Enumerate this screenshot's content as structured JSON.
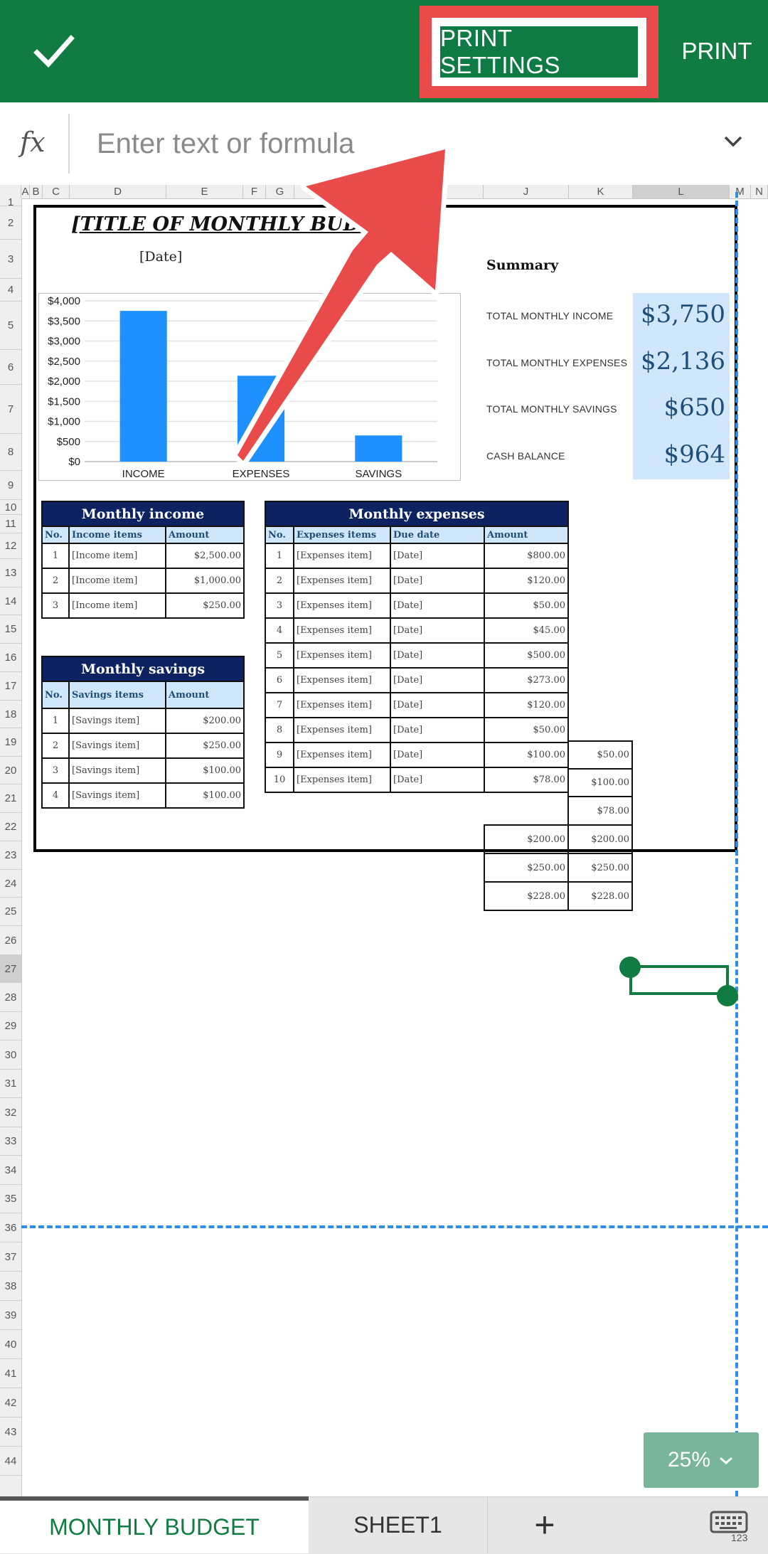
{
  "topbar": {
    "print_settings_label": "PRINT SETTINGS",
    "print_label": "PRINT"
  },
  "formula": {
    "fx_label": "fx",
    "placeholder": "Enter text or formula"
  },
  "columns": [
    "A",
    "B",
    "C",
    "D",
    "E",
    "F",
    "G",
    "H",
    "I",
    "J",
    "K",
    "L",
    "M",
    "N"
  ],
  "rows": [
    "1",
    "2",
    "3",
    "4",
    "5",
    "6",
    "7",
    "8",
    "9",
    "10",
    "11",
    "12",
    "13",
    "14",
    "15",
    "16",
    "17",
    "18",
    "19",
    "20",
    "21",
    "22",
    "23",
    "24",
    "25",
    "26",
    "27",
    "28",
    "29",
    "30",
    "31",
    "32",
    "33",
    "34",
    "35",
    "36",
    "37",
    "38",
    "39",
    "40",
    "41",
    "42",
    "43",
    "44"
  ],
  "sheet": {
    "title": "[TITLE OF MONTHLY BUDGET]",
    "date": "[Date]",
    "summary": {
      "heading": "Summary",
      "items": [
        {
          "label": "TOTAL MONTHLY  INCOME",
          "value": "$3,750"
        },
        {
          "label": "TOTAL MONTHLY  EXPENSES",
          "value": "$2,136"
        },
        {
          "label": "TOTAL MONTHLY  SAVINGS",
          "value": "$650"
        },
        {
          "label": "CASH BALANCE",
          "value": "$964"
        }
      ]
    },
    "income": {
      "title": "Monthly income",
      "headers": [
        "No.",
        "Income items",
        "Amount"
      ],
      "rows": [
        [
          "1",
          "[Income item]",
          "$2,500.00"
        ],
        [
          "2",
          "[Income item]",
          "$1,000.00"
        ],
        [
          "3",
          "[Income item]",
          "$250.00"
        ]
      ]
    },
    "savings": {
      "title": "Monthly savings",
      "headers": [
        "No.",
        "Savings items",
        "Amount"
      ],
      "rows": [
        [
          "1",
          "[Savings item]",
          "$200.00"
        ],
        [
          "2",
          "[Savings item]",
          "$250.00"
        ],
        [
          "3",
          "[Savings item]",
          "$100.00"
        ],
        [
          "4",
          "[Savings item]",
          "$100.00"
        ]
      ]
    },
    "expenses": {
      "title": "Monthly expenses",
      "headers": [
        "No.",
        "Expenses items",
        "Due date",
        "Amount"
      ],
      "rows": [
        [
          "1",
          "[Expenses item]",
          "[Date]",
          "$800.00"
        ],
        [
          "2",
          "[Expenses item]",
          "[Date]",
          "$120.00"
        ],
        [
          "3",
          "[Expenses item]",
          "[Date]",
          "$50.00"
        ],
        [
          "4",
          "[Expenses item]",
          "[Date]",
          "$45.00"
        ],
        [
          "5",
          "[Expenses item]",
          "[Date]",
          "$500.00"
        ],
        [
          "6",
          "[Expenses item]",
          "[Date]",
          "$273.00"
        ],
        [
          "7",
          "[Expenses item]",
          "[Date]",
          "$120.00"
        ],
        [
          "8",
          "[Expenses item]",
          "[Date]",
          "$50.00"
        ],
        [
          "9",
          "[Expenses item]",
          "[Date]",
          "$100.00"
        ],
        [
          "10",
          "[Expenses item]",
          "[Date]",
          "$78.00"
        ]
      ],
      "overflow_amounts": [
        "$200.00",
        "$250.00",
        "$228.00"
      ]
    },
    "side_column": [
      "$50.00",
      "$100.00",
      "$78.00",
      "$200.00",
      "$250.00",
      "$228.00"
    ]
  },
  "chart_data": {
    "type": "bar",
    "categories": [
      "INCOME",
      "EXPENSES",
      "SAVINGS"
    ],
    "values": [
      3750,
      2136,
      650
    ],
    "ylim": [
      0,
      4000
    ],
    "yticks": [
      "$0",
      "$500",
      "$1,000",
      "$1,500",
      "$2,000",
      "$2,500",
      "$3,000",
      "$3,500",
      "$4,000"
    ],
    "ytick_values": [
      0,
      500,
      1000,
      1500,
      2000,
      2500,
      3000,
      3500,
      4000
    ],
    "color": "#1e90ff",
    "grid": true
  },
  "zoom": {
    "label": "25%"
  },
  "tabs": {
    "active": "MONTHLY BUDGET",
    "other": "SHEET1",
    "add": "+"
  },
  "colors": {
    "accent": "#107c41",
    "highlight": "#e94b4b",
    "page_break": "#2f8fe6"
  }
}
